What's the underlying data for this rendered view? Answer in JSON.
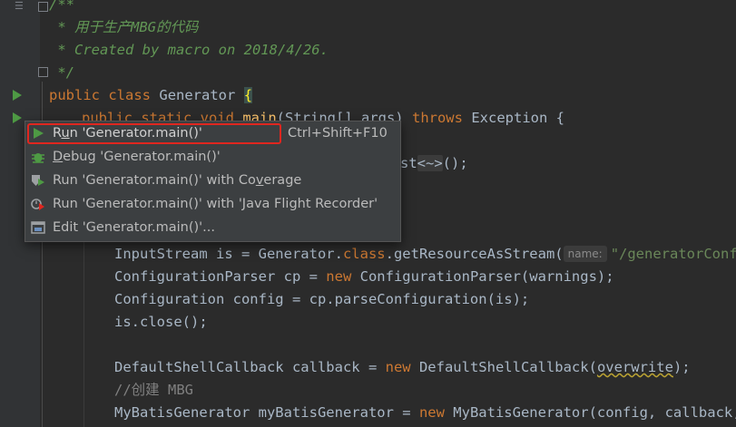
{
  "editor": {
    "comment": {
      "open": "/**",
      "line1": " * 用于生产MBG的代码",
      "line2": " * Created by macro on 2018/4/26.",
      "close": " */"
    },
    "class_decl": {
      "public": "public",
      "class": "class",
      "name": "Generator",
      "brace": "{"
    },
    "main_decl": {
      "modifiers": "public static void",
      "name": "main",
      "params": "(String[] args)",
      "throws": "throws",
      "exception": "Exception {"
    },
    "partial_line": {
      "text_st": "st",
      "diamond": "<~>",
      "tail": "();"
    },
    "line_inputstream": {
      "pre": "InputStream is = Generator.",
      "kw_class": "class",
      "mid": ".getResourceAsStream(",
      "hint": "name:",
      "str": "\"/generatorConfig"
    },
    "line_parser": {
      "pre": "ConfigurationParser cp = ",
      "kw_new": "new",
      "post": " ConfigurationParser(warnings);"
    },
    "line_config": {
      "text": "Configuration config = cp.parseConfiguration(is);"
    },
    "line_close": {
      "text": "is.close();"
    },
    "line_callback": {
      "pre": "DefaultShellCallback callback = ",
      "kw_new": "new",
      "mid": " DefaultShellCallback(",
      "warn": "overwrite",
      "post": ");"
    },
    "line_comment2": {
      "text": "//创建 MBG"
    },
    "line_mbg": {
      "pre": "MyBatisGenerator myBatisGenerator = ",
      "kw_new": "new",
      "post": " MyBatisGenerator(config, callback, w"
    }
  },
  "context_menu": {
    "items": [
      {
        "label_pre": "R",
        "label_u": "u",
        "label_post": "n 'Generator.main()'",
        "shortcut": "Ctrl+Shift+F10",
        "icon": "run-icon"
      },
      {
        "label_pre": "",
        "label_u": "D",
        "label_post": "ebug 'Generator.main()'",
        "shortcut": "",
        "icon": "debug-icon"
      },
      {
        "label_pre": "Run 'Generator.main()' with Co",
        "label_u": "v",
        "label_post": "erage",
        "shortcut": "",
        "icon": "coverage-icon"
      },
      {
        "label_pre": "Run 'Generator.main()' with 'Java Flight Recorder'",
        "label_u": "",
        "label_post": "",
        "shortcut": "",
        "icon": "profiler-icon"
      },
      {
        "label_pre": "Edit 'Generator.main()'...",
        "label_u": "",
        "label_post": "",
        "shortcut": "",
        "icon": "edit-config-icon"
      }
    ]
  },
  "colors": {
    "background": "#2b2b2b",
    "keyword": "#cc7832",
    "method": "#ffc66d",
    "doc_comment": "#629755",
    "string": "#6a8759",
    "highlight_box": "#e0261f",
    "run_green": "#4e9a44"
  }
}
